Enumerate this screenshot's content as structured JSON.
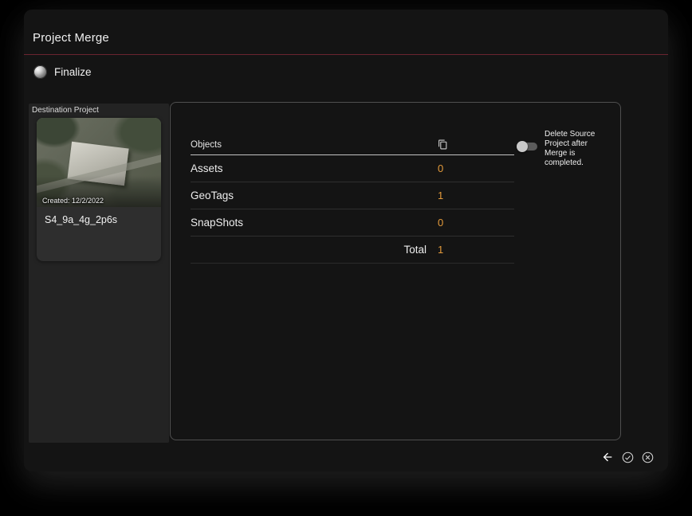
{
  "window": {
    "title": "Project Merge"
  },
  "stepper": {
    "label": "Finalize",
    "icon": "sphere-step-icon"
  },
  "sidebar": {
    "section_label": "Destination Project",
    "project": {
      "created": "Created: 12/2/2022",
      "name": "S4_9a_4g_2p6s"
    }
  },
  "panel": {
    "table": {
      "header": "Objects",
      "header_icon": "copy-stack-icon",
      "rows": [
        {
          "label": "Assets",
          "value": "0"
        },
        {
          "label": "GeoTags",
          "value": "1"
        },
        {
          "label": "SnapShots",
          "value": "0"
        }
      ],
      "total_label": "Total",
      "total_value": "1"
    },
    "delete_toggle": {
      "label": "Delete Source Project after Merge is completed.",
      "state": "off"
    }
  },
  "footer": {
    "back_icon": "back-arrow-icon",
    "confirm_icon": "check-circle-icon",
    "close_icon": "close-circle-icon"
  },
  "colors": {
    "value_accent": "#E39A3B",
    "title_divider": "#6B2430",
    "window_bg": "#141414",
    "sidebar_bg": "#232323"
  }
}
